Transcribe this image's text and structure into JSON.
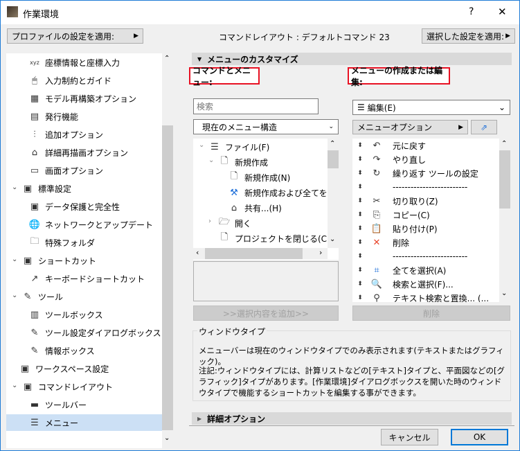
{
  "window": {
    "title": "作業環境",
    "help": "?",
    "close": "✕"
  },
  "top": {
    "profile_btn": "プロファイルの設定を適用:",
    "layout_info": "コマンドレイアウト : デフォルトコマンド 23",
    "apply_selected_btn": "選択した設定を適用:"
  },
  "sidebar": {
    "items": [
      {
        "label": "座標情報と座標入力",
        "icon": "xyz-icon",
        "glyph": "xyz",
        "level": 2
      },
      {
        "label": "入力制約とガイド",
        "icon": "mouse-icon",
        "glyph": "🖱",
        "level": 2
      },
      {
        "label": "モデル再構築オプション",
        "icon": "bricks-icon",
        "glyph": "▦",
        "level": 2
      },
      {
        "label": "発行機能",
        "icon": "publish-icon",
        "glyph": "▤",
        "level": 2
      },
      {
        "label": "追加オプション",
        "icon": "sliders-icon",
        "glyph": "⫶",
        "level": 2
      },
      {
        "label": "詳細再描画オプション",
        "icon": "redraw-icon",
        "glyph": "⌂",
        "level": 2
      },
      {
        "label": "画面オプション",
        "icon": "monitor-icon",
        "glyph": "▭",
        "level": 2
      },
      {
        "label": "標準設定",
        "icon": "save-settings-icon",
        "glyph": "▣",
        "level": 1
      },
      {
        "label": "データ保護と完全性",
        "icon": "data-safety-icon",
        "glyph": "▣",
        "level": 2
      },
      {
        "label": "ネットワークとアップデート",
        "icon": "globe-icon",
        "glyph": "🌐",
        "level": 2
      },
      {
        "label": "特殊フォルダ",
        "icon": "folder-icon",
        "glyph": "🗀",
        "level": 2
      },
      {
        "label": "ショートカット",
        "icon": "shortcut-icon",
        "glyph": "▣",
        "level": 1
      },
      {
        "label": "キーボードショートカット",
        "icon": "shortcut-arrow-icon",
        "glyph": "↗",
        "level": 2
      },
      {
        "label": "ツール",
        "icon": "tools-icon",
        "glyph": "✎",
        "level": 1
      },
      {
        "label": "ツールボックス",
        "icon": "toolbox-icon",
        "glyph": "▥",
        "level": 2
      },
      {
        "label": "ツール設定ダイアログボックス",
        "icon": "tool-settings-icon",
        "glyph": "✎",
        "level": 2
      },
      {
        "label": "情報ボックス",
        "icon": "infobox-icon",
        "glyph": "✎",
        "level": 2
      },
      {
        "label": "ワークスペース設定",
        "icon": "workspace-icon",
        "glyph": "▣",
        "level": 1.5
      },
      {
        "label": "コマンドレイアウト",
        "icon": "command-layout-icon",
        "glyph": "▣",
        "level": 1
      },
      {
        "label": "ツールバー",
        "icon": "toolbar-icon",
        "glyph": "▬",
        "level": 2
      },
      {
        "label": "メニュー",
        "icon": "menu-icon",
        "glyph": "☰",
        "level": 2,
        "selected": true
      }
    ]
  },
  "customize": {
    "section_title": "メニューのカスタマイズ",
    "commands_label": "コマンドとメニュー:",
    "menus_label": "メニューの作成または編集:",
    "search_placeholder": "検索",
    "structure_select": "現在のメニュー構造",
    "add_btn": ">>選択内容を追加>>",
    "tree": [
      {
        "label": "ファイル(F)",
        "icon": "list-icon",
        "glyph": "☰",
        "indent": 0,
        "chev": "⌄"
      },
      {
        "label": "新規作成",
        "icon": "document-icon",
        "glyph": "🗋",
        "indent": 1,
        "chev": "⌄"
      },
      {
        "label": "新規作成(N)",
        "icon": "document-icon",
        "glyph": "🗋",
        "indent": 2,
        "chev": ""
      },
      {
        "label": "新規作成および全てをリセット",
        "icon": "reset-icon",
        "glyph": "⚒",
        "indent": 2,
        "chev": ""
      },
      {
        "label": "共有...(H)",
        "icon": "share-icon",
        "glyph": "⌂",
        "indent": 2,
        "chev": ""
      },
      {
        "label": "開く",
        "icon": "open-folder-icon",
        "glyph": "🗁",
        "indent": 1,
        "chev": "›"
      },
      {
        "label": "プロジェクトを閉じる(C)",
        "icon": "close-doc-icon",
        "glyph": "🗋",
        "indent": 1,
        "chev": ""
      }
    ],
    "menu_select": "編集(E)",
    "menu_options_btn": "メニューオプション",
    "delete_btn": "削除",
    "menu_items": [
      {
        "label": "元に戻す",
        "icon": "undo-icon",
        "glyph": "↶",
        "color": "#333333"
      },
      {
        "label": "やり直し",
        "icon": "redo-icon",
        "glyph": "↷",
        "color": "#333333"
      },
      {
        "label": "繰り返す ツールの設定",
        "icon": "repeat-icon",
        "glyph": "↻",
        "color": "#333333"
      },
      {
        "label": "-------------------------",
        "icon": "",
        "glyph": "",
        "color": "#333333"
      },
      {
        "label": "切り取り(Z)",
        "icon": "scissors-icon",
        "glyph": "✂",
        "color": "#333333"
      },
      {
        "label": "コピー(C)",
        "icon": "copy-icon",
        "glyph": "⎘",
        "color": "#333333"
      },
      {
        "label": "貼り付け(P)",
        "icon": "paste-icon",
        "glyph": "📋",
        "color": "#1e6fd9"
      },
      {
        "label": "削除",
        "icon": "delete-icon",
        "glyph": "✕",
        "color": "#e8442a"
      },
      {
        "label": "-------------------------",
        "icon": "",
        "glyph": "",
        "color": "#333333"
      },
      {
        "label": "全てを選択(A)",
        "icon": "select-all-icon",
        "glyph": "⌗",
        "color": "#1e6fd9"
      },
      {
        "label": "検索と選択(F)...",
        "icon": "find-select-icon",
        "glyph": "🔍",
        "color": "#1e6fd9"
      },
      {
        "label": "テキスト検索と置換... (...",
        "icon": "binoculars-icon",
        "glyph": "⚲",
        "color": "#333333"
      }
    ]
  },
  "window_type": {
    "title": "ウィンドウタイプ",
    "text1": "メニューバーは現在のウィンドウタイプでのみ表示されます(テキストまたはグラフィック)。",
    "text2": "注記:ウィンドウタイプには、計算リストなどの[テキスト]タイプと、平面図などの[グラフィック]タイプがあります。[作業環境]ダイアログボックスを開いた時のウィンドウタイプで機能するショートカットを編集する事ができます。"
  },
  "advanced": {
    "title": "詳細オプション"
  },
  "footer": {
    "cancel": "キャンセル",
    "ok": "OK"
  }
}
